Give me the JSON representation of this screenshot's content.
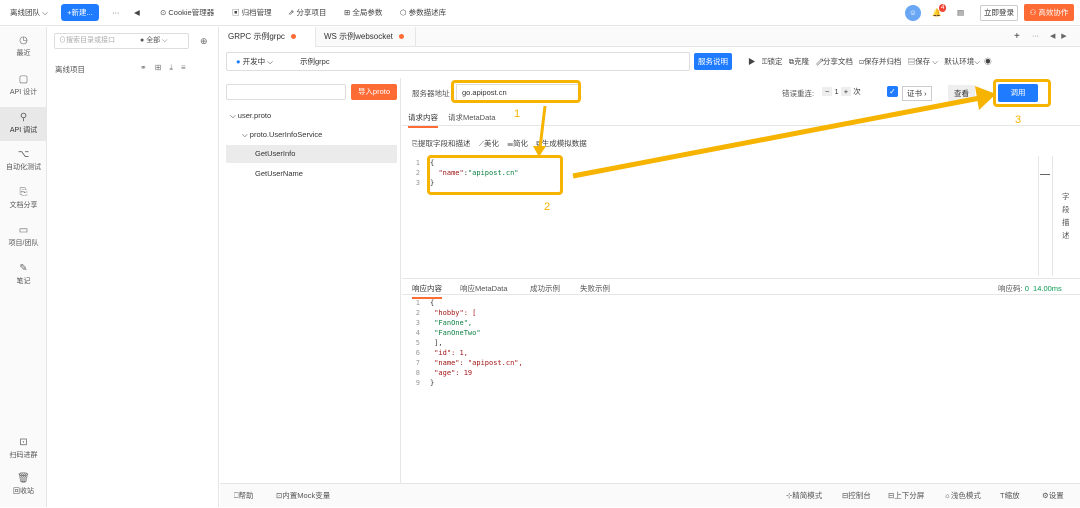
{
  "topbar": {
    "team": "离线团队",
    "new_btn": "+新建...",
    "more": "···",
    "cookie": "Cookie管理器",
    "archive": "归档管理",
    "share": "分享项目",
    "global_params": "全局参数",
    "params_lib": "参数描述库",
    "notif_count": "4",
    "login": "立即登录",
    "collab": "高效协作"
  },
  "leftnav": {
    "items": [
      {
        "label": "最近",
        "icon": "clock-icon"
      },
      {
        "label": "API 设计",
        "icon": "file-icon"
      },
      {
        "label": "API 调试",
        "icon": "link-icon"
      },
      {
        "label": "自动化测试",
        "icon": "flow-icon"
      },
      {
        "label": "文档分享",
        "icon": "share-icon"
      },
      {
        "label": "项目/团队",
        "icon": "folder-icon"
      },
      {
        "label": "笔记",
        "icon": "note-icon"
      }
    ],
    "scan": "扫码进群",
    "trash": "回收站"
  },
  "tree": {
    "search_placeholder": "搜索目录或接口",
    "filter": "全部",
    "project": "离线项目"
  },
  "tabs": [
    {
      "label": "GRPC 示例grpc"
    },
    {
      "label": "WS 示例websocket"
    }
  ],
  "url": {
    "env": "开发中",
    "name": "示例grpc",
    "service_doc": "服务说明",
    "lock": "锁定",
    "clone": "克隆",
    "share_doc": "分享文档",
    "save_archive": "保存并归档",
    "save": "保存",
    "env_default": "默认环境"
  },
  "proto": {
    "import": "导入proto",
    "file": "user.proto",
    "service": "proto.UserInfoService",
    "methods": [
      "GetUserInfo",
      "GetUserName"
    ]
  },
  "req": {
    "server_label": "服务器地址",
    "server_value": "go.apipost.cn",
    "retry_label": "错误重连:",
    "retry_value": "1",
    "retry_unit": "次",
    "cert": "证书",
    "view": "查看",
    "invoke": "调用",
    "tab_body": "请求内容",
    "tab_meta": "请求MetaData",
    "tool_extract": "提取字段和描述",
    "tool_beautify": "美化",
    "tool_simplify": "简化",
    "tool_mock": "生成模拟数据",
    "side_label": "字段描述"
  },
  "req_code": [
    {
      "n": "1",
      "t": "{"
    },
    {
      "n": "2",
      "k": "\"name\"",
      "v": "\"apipost.cn\""
    },
    {
      "n": "3",
      "t": "}"
    }
  ],
  "resp": {
    "tab_body": "响应内容",
    "tab_meta": "响应MetaData",
    "tab_success": "成功示例",
    "tab_fail": "失败示例",
    "code_label": "响应码:",
    "code": "0",
    "time": "14.00ms"
  },
  "resp_code": [
    "{",
    "  \"hobby\": [",
    "    \"FanOne\",",
    "    \"FanOneTwo\"",
    "  ],",
    "  \"id\": 1,",
    "  \"name\": \"apipost.cn\",",
    "  \"age\": 19",
    "}"
  ],
  "annotations": [
    "1",
    "2",
    "3"
  ],
  "bottom": {
    "help": "帮助",
    "mock": "内置Mock变量",
    "compact": "精简模式",
    "console": "控制台",
    "split": "上下分屏",
    "light": "浅色模式",
    "zoom": "缩放",
    "settings": "设置"
  }
}
